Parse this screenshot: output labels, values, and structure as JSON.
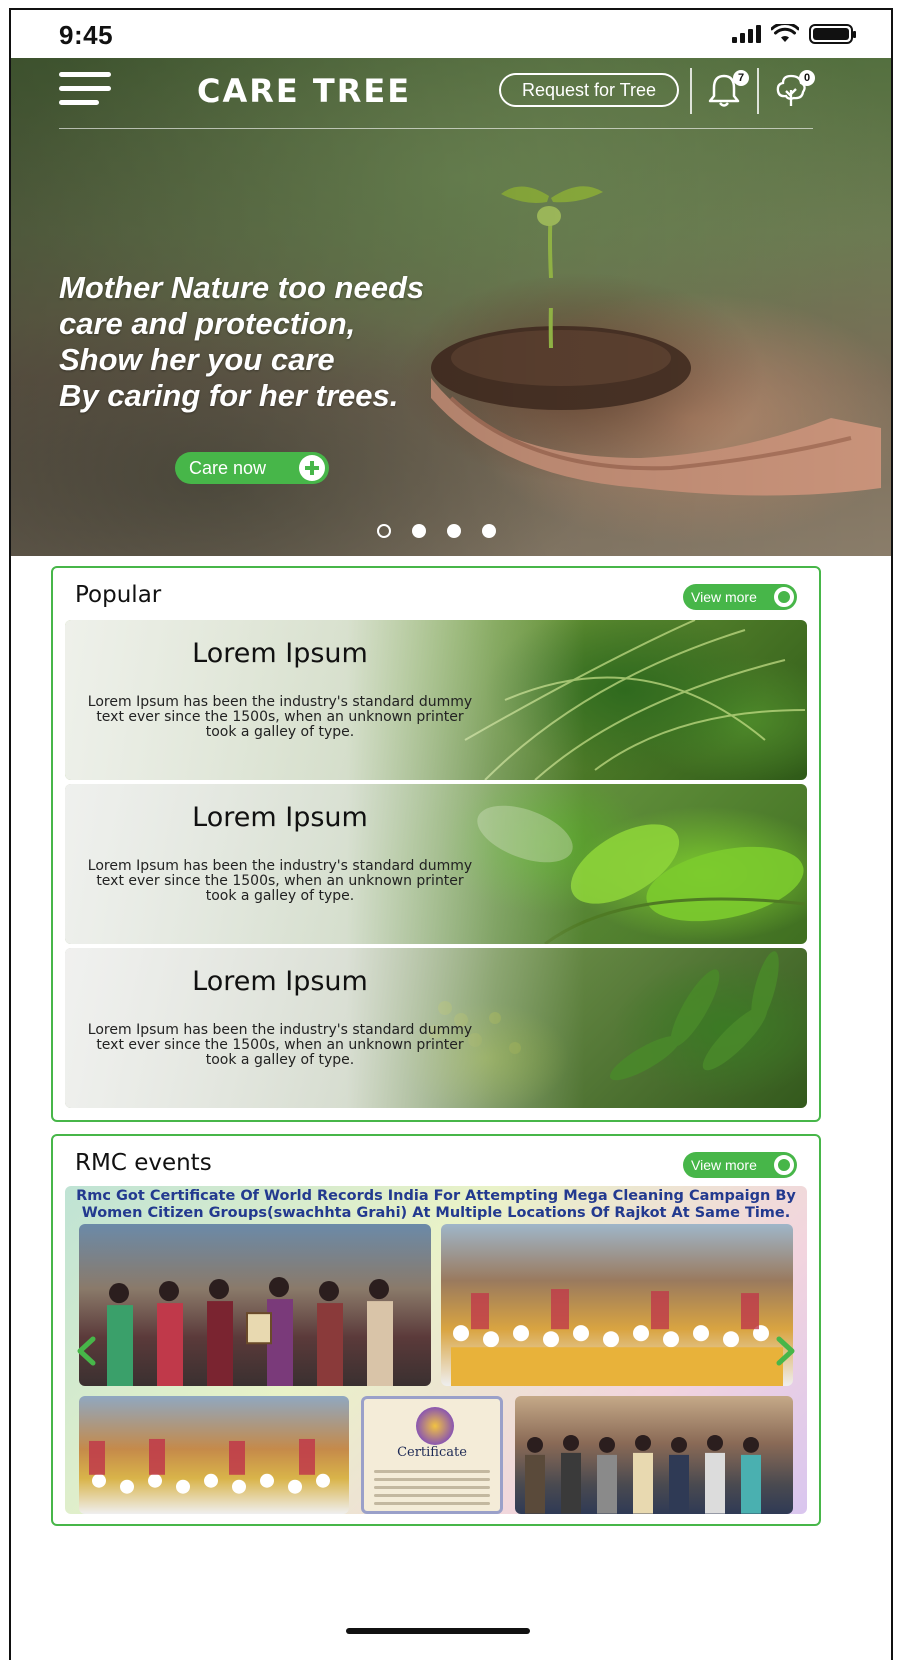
{
  "status_bar": {
    "time": "9:45"
  },
  "header": {
    "brand": "CARE TREE",
    "request_label": "Request for Tree",
    "notification_count": "7",
    "tree_count": "0"
  },
  "hero": {
    "lines": [
      "Mother Nature too needs",
      "care and protection,",
      "Show her you care",
      "By caring for her trees."
    ],
    "cta_label": "Care now",
    "slides": 4,
    "active_slide": 0
  },
  "popular": {
    "title": "Popular",
    "view_more_label": "View more",
    "items": [
      {
        "title": "Lorem Ipsum",
        "description": "Lorem Ipsum has been the industry's standard dummy text ever since the 1500s, when an unknown printer took a galley of type."
      },
      {
        "title": "Lorem Ipsum",
        "description": "Lorem Ipsum has been the industry's standard dummy text ever since the 1500s, when an unknown printer took a galley of type."
      },
      {
        "title": "Lorem Ipsum",
        "description": "Lorem Ipsum has been the industry's standard dummy text ever since the 1500s, when an unknown printer took a galley of type."
      }
    ]
  },
  "events": {
    "title": "RMC events",
    "view_more_label": "View more",
    "caption": "Rmc Got Certificate Of World Records India For Attempting Mega Cleaning Campaign By Women Citizen Groups(swachhta Grahi) At Multiple Locations Of Rajkot At Same Time.",
    "certificate_label": "Certificate"
  },
  "colors": {
    "accent": "#47b649",
    "caption_blue": "#233a8f"
  },
  "icons": {
    "menu": "hamburger-icon",
    "notifications": "bell-icon",
    "trees": "tree-icon",
    "add": "plus-circle-icon"
  }
}
